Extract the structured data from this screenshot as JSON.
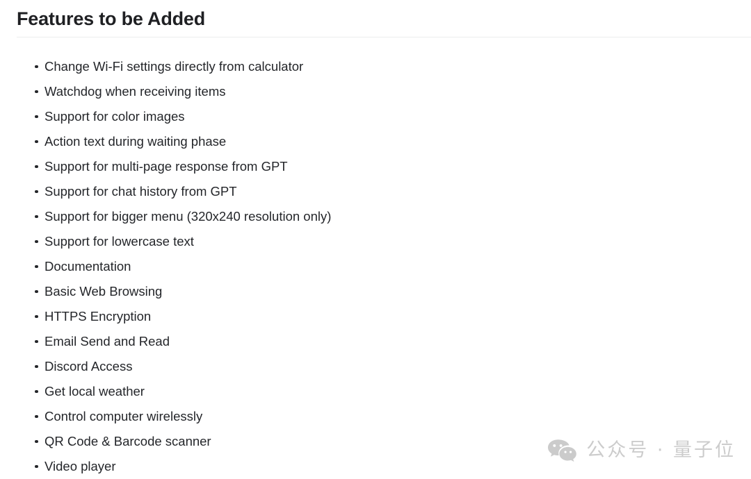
{
  "document": {
    "title": "Features to be Added",
    "background_color": "#ffffff",
    "text_color": "#24262a",
    "rule_color": "#eceded"
  },
  "features": {
    "items": [
      {
        "label": "Change Wi-Fi settings directly from calculator"
      },
      {
        "label": "Watchdog when receiving items"
      },
      {
        "label": "Support for color images"
      },
      {
        "label": "Action text during waiting phase"
      },
      {
        "label": "Support for multi-page response from GPT"
      },
      {
        "label": "Support for chat history from GPT"
      },
      {
        "label": "Support for bigger menu (320x240 resolution only)"
      },
      {
        "label": "Support for lowercase text"
      },
      {
        "label": "Documentation"
      },
      {
        "label": "Basic Web Browsing"
      },
      {
        "label": "HTTPS Encryption"
      },
      {
        "label": "Email Send and Read"
      },
      {
        "label": "Discord Access"
      },
      {
        "label": "Get local weather"
      },
      {
        "label": "Control computer wirelessly"
      },
      {
        "label": "QR Code & Barcode scanner"
      },
      {
        "label": "Video player"
      }
    ]
  },
  "watermark": {
    "icon": "wechat-icon",
    "text": "公众号 · 量子位",
    "color": "#cccccc"
  }
}
